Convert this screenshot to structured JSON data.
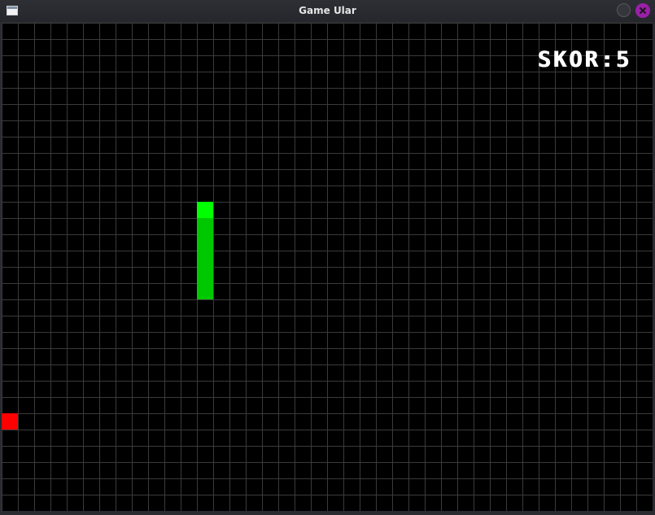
{
  "window": {
    "title": "Game Ular",
    "icon": "app-window-icon",
    "close_color": "#9b1fa8"
  },
  "game": {
    "score_label": "SKOR:5",
    "grid_columns": 40,
    "grid_rows": 30,
    "snake": {
      "head": [
        12,
        11
      ],
      "body": [
        [
          12,
          12
        ],
        [
          12,
          13
        ],
        [
          12,
          14
        ],
        [
          12,
          15
        ],
        [
          12,
          16
        ]
      ],
      "head_color": "#00ff00",
      "body_color": "#00c800"
    },
    "food": {
      "cell": [
        0,
        24
      ],
      "color": "#ff0000"
    },
    "background_color": "#000000",
    "grid_color": "#3a3a3a"
  }
}
